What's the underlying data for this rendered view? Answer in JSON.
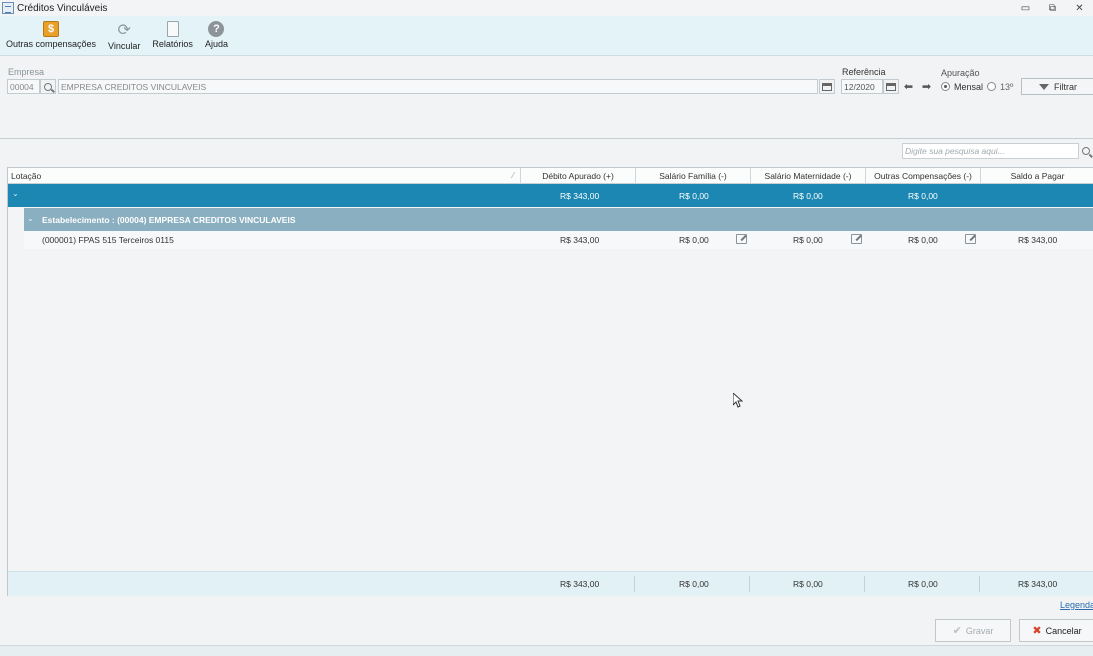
{
  "window": {
    "title": "Créditos Vinculáveis",
    "controls": [
      "▭",
      "⧉",
      "✕"
    ]
  },
  "toolbar": {
    "items": [
      {
        "label": "Outras compensações",
        "icon": "dollar-icon"
      },
      {
        "label": "Vincular",
        "icon": "refresh-icon"
      },
      {
        "label": "Relatórios",
        "icon": "document-icon"
      },
      {
        "label": "Ajuda",
        "icon": "help-icon"
      }
    ]
  },
  "filters": {
    "empresa_label": "Empresa",
    "empresa_code": "00004",
    "empresa_name": "EMPRESA CREDITOS VINCULAVEIS",
    "referencia_label": "Referência",
    "referencia_value": "12/2020",
    "apuracao_label": "Apuração",
    "apuracao_options": [
      "Mensal",
      "13º"
    ],
    "apuracao_selected": "Mensal",
    "filtrar_label": "Filtrar"
  },
  "search": {
    "placeholder": "Digite sua pesquisa aqui..."
  },
  "grid": {
    "columns": [
      "Lotação",
      "Débito Apurado (+)",
      "Salário Família (-)",
      "Salário Maternidade (-)",
      "Outras Compensações (-)",
      "Saldo a Pagar"
    ],
    "summary_row": {
      "debito": "R$ 343,00",
      "familia": "R$ 0,00",
      "maternidade": "R$ 0,00",
      "outras": "R$ 0,00"
    },
    "group_row": {
      "label": "Estabelecimento : (00004) EMPRESA CREDITOS VINCULAVEIS"
    },
    "rows": [
      {
        "lotacao": "(000001) FPAS 515 Terceiros 0115",
        "debito": "R$ 343,00",
        "familia": "R$ 0,00",
        "maternidade": "R$ 0,00",
        "outras": "R$ 0,00",
        "saldo": "R$ 343,00"
      }
    ],
    "footer": {
      "debito": "R$ 343,00",
      "familia": "R$ 0,00",
      "maternidade": "R$ 0,00",
      "outras": "R$ 0,00",
      "saldo": "R$ 343,00"
    }
  },
  "legenda_label": "Legenda",
  "actions": {
    "gravar_label": "Gravar",
    "cancelar_label": "Cancelar"
  }
}
